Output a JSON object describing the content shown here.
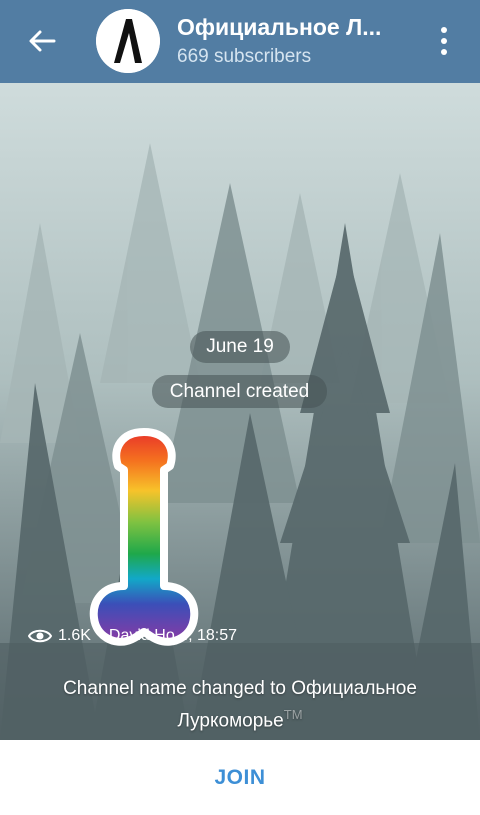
{
  "header": {
    "title": "Официальное Л...",
    "subscribers": "669 subscribers",
    "back_icon": "arrow-left-icon",
    "menu_icon": "more-vertical-icon"
  },
  "chat": {
    "date": "June 19",
    "service_created": "Channel created",
    "message_meta": {
      "views": "1.6K",
      "author_time": "David Ho..., 18:57"
    },
    "service_renamed": "Channel name changed to Официальное Луркоморье",
    "trademark": "TM"
  },
  "bottom_bar": {
    "join_label": "JOIN"
  },
  "colors": {
    "header_bg": "#527da3",
    "join_text": "#3d8fd6"
  }
}
